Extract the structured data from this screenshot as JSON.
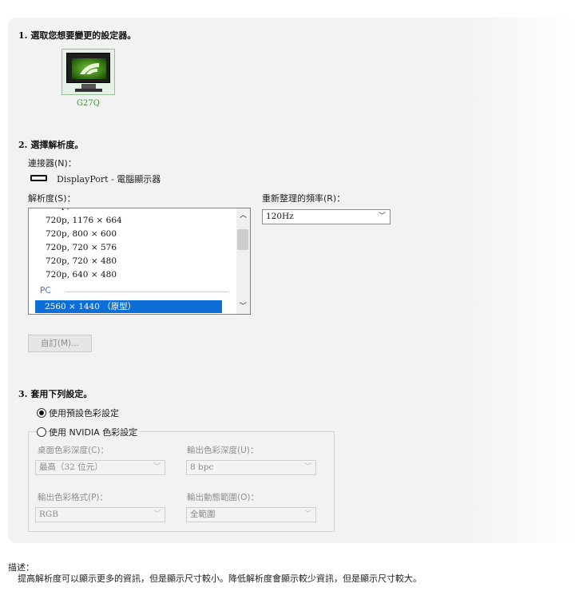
{
  "step1": {
    "title": "1. 選取您想要變更的設定器。",
    "display_name": "G27Q",
    "display_icon": "nvidia-monitor-icon"
  },
  "step2": {
    "title": "2. 選擇解析度。",
    "connector_label": "連接器(N)：",
    "connector_value": "DisplayPort - 電腦顯示器",
    "resolution_label": "解析度(S)：",
    "refresh_label": "重新整理的頻率(R)：",
    "refresh_value": "120Hz",
    "resolution_items": [
      "720p, 1176 × 664",
      "720p, 800 × 600",
      "720p, 720 × 576",
      "720p, 720 × 480",
      "720p, 640 × 480"
    ],
    "resolution_group": "PC",
    "resolution_selected": "2560 × 1440 （原型）",
    "customize_label": "自訂(M)..."
  },
  "step3": {
    "title": "3. 套用下列設定。",
    "option_default": "使用預設色彩設定",
    "option_nvidia": "使用 NVIDIA 色彩設定",
    "selected_option": "default",
    "desktop_depth_label": "桌面色彩深度(C)：",
    "desktop_depth_value": "最高（32 位元）",
    "output_depth_label": "輸出色彩深度(U)：",
    "output_depth_value": "8 bpc",
    "output_format_label": "輸出色彩格式(P)：",
    "output_format_value": "RGB",
    "output_range_label": "輸出動態範圍(O)：",
    "output_range_value": "全範圍"
  },
  "description": {
    "label": "描述：",
    "text": "提高解析度可以顯示更多的資訊，但是顯示尺寸較小。降低解析度會顯示較少資訊，但是顯示尺寸較大。"
  },
  "colors": {
    "selection": "#0c6ed6",
    "group_header": "#3c79c9",
    "monitor_label": "#2e9e2e",
    "panel_bg": "#f2f2f2"
  }
}
